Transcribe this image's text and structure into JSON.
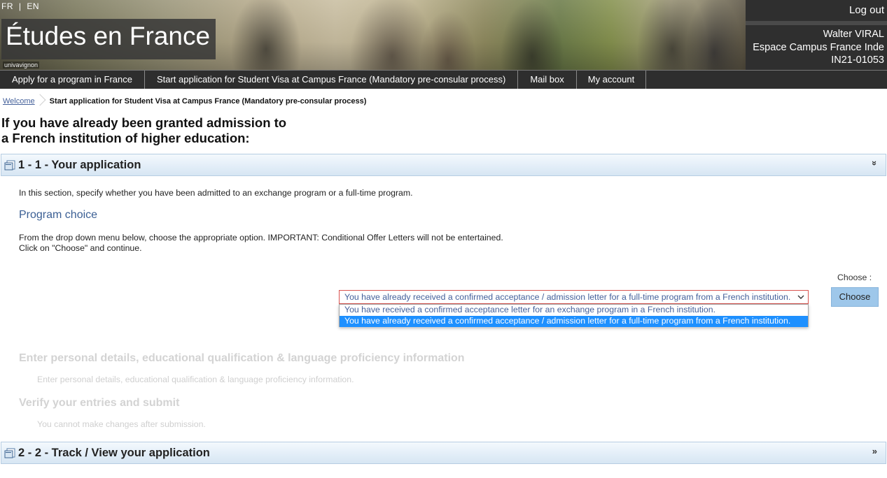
{
  "header": {
    "lang_fr": "FR",
    "lang_sep": "|",
    "lang_en": "EN",
    "site_title": "Études en France",
    "logo_caption": "univavignon",
    "logout": "Log out",
    "user_name": "Walter VIRAL",
    "user_office": "Espace Campus France Inde",
    "user_id": "IN21-01053"
  },
  "nav": {
    "items": [
      "Apply for a program in France",
      "Start application for Student Visa at Campus France (Mandatory pre-consular process)",
      "Mail box",
      "My account"
    ]
  },
  "breadcrumb": {
    "home": "Welcome",
    "current": "Start application for Student Visa at Campus France (Mandatory pre-consular process)"
  },
  "page": {
    "heading_line1": "If you have already been granted admission to",
    "heading_line2": "a French institution of higher education:"
  },
  "section1": {
    "title": "1 - 1 - Your application",
    "chevron": "»",
    "intro": "In this section, specify whether you have been admitted to an exchange program or a full-time program.",
    "subtitle": "Program choice",
    "instruction_line1": "From the drop down menu below, choose the appropriate option. IMPORTANT: Conditional Offer Letters will not be entertained.",
    "instruction_line2": "Click on \"Choose\" and continue.",
    "choose_label": "Choose :",
    "choose_button": "Choose",
    "select": {
      "selected": "You have already received a confirmed acceptance / admission letter for a full-time program from a French institution.",
      "options": [
        "You have received a confirmed acceptance letter for an exchange program in a French institution.",
        "You have already received a confirmed acceptance / admission letter for a full-time program from a French institution."
      ]
    },
    "steps": [
      {
        "title": "Enter personal details, educational qualification & language proficiency information",
        "desc": "Enter personal details, educational qualification & language proficiency information."
      },
      {
        "title": "Verify your entries and submit",
        "desc": "You cannot make changes after submission."
      }
    ]
  },
  "section2": {
    "title": "2 - 2 - Track / View your application",
    "chevron": "»"
  },
  "colors": {
    "nav_bg": "#2e2e2e",
    "section_header_border": "#b6cde2",
    "link_blue": "#44609a",
    "choose_button_bg": "#9ec7ea",
    "selected_option_bg": "#1e90ff",
    "select_error_border": "#d9534f"
  }
}
